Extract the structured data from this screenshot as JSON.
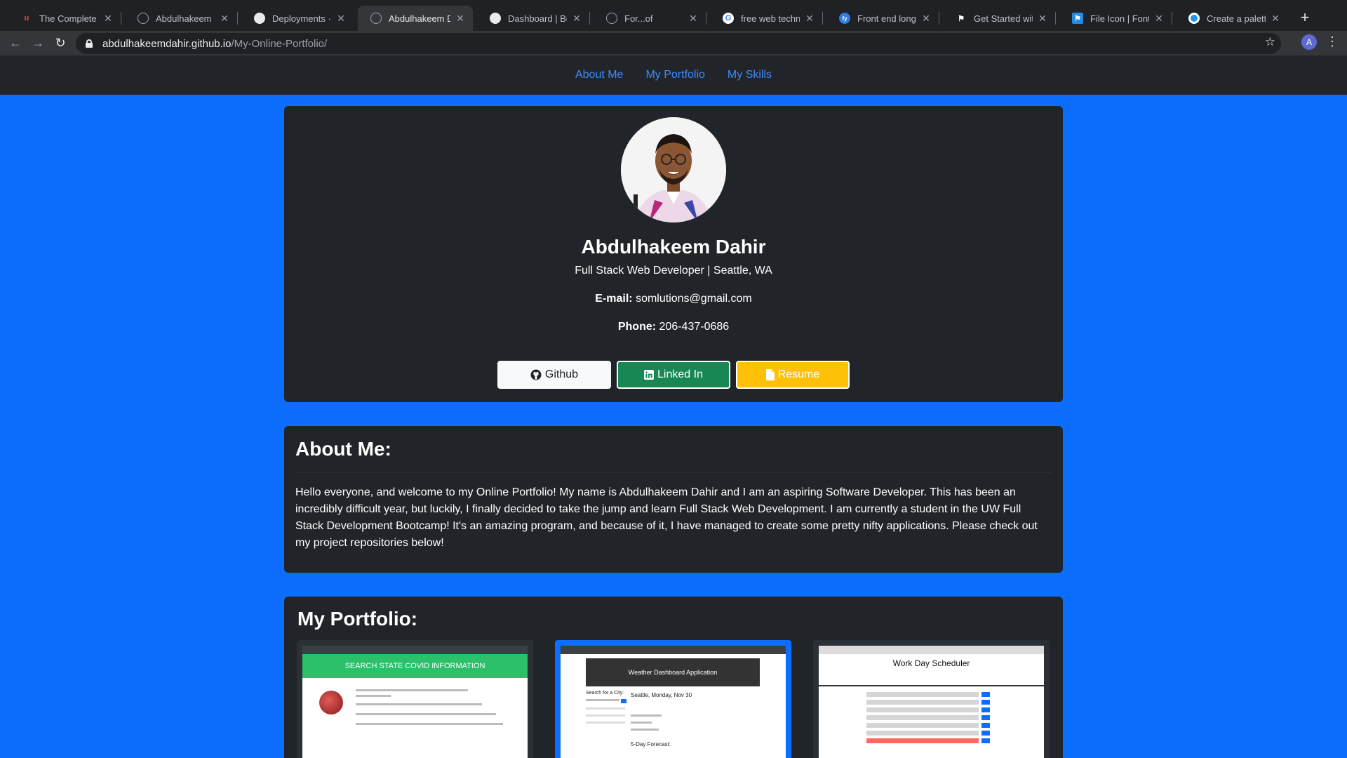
{
  "browser": {
    "tabs": [
      {
        "title": "The Complete JavaScript",
        "icon": "udemy-icon"
      },
      {
        "title": "Abdulhakeem Dahir",
        "icon": "globe-icon"
      },
      {
        "title": "Deployments · abdulhakeemdahir",
        "icon": "github-icon"
      },
      {
        "title": "Abdulhakeem Dahir",
        "icon": "globe-icon",
        "active": true
      },
      {
        "title": "Dashboard | Bootstrap",
        "icon": "github-icon"
      },
      {
        "title": "For...of",
        "icon": "globe-icon"
      },
      {
        "title": "free web technologies",
        "icon": "google-icon"
      },
      {
        "title": "Front end long shadow",
        "icon": "fy-icon"
      },
      {
        "title": "Get Started with Font Awesome",
        "icon": "flag-icon"
      },
      {
        "title": "File Icon | Font Awesome",
        "icon": "flag-icon"
      },
      {
        "title": "Create a palette",
        "icon": "coolors-icon"
      }
    ],
    "url_host": "abdulhakeemdahir.github.io",
    "url_path": "/My-Online-Portfolio/",
    "profile_initial": "A"
  },
  "nav": {
    "links": [
      "About Me",
      "My Portfolio",
      "My Skills"
    ]
  },
  "profile": {
    "name": "Abdulhakeem Dahir",
    "subtitle": "Full Stack Web Developer | Seattle, WA",
    "email_label": "E-mail:",
    "email": "somlutions@gmail.com",
    "phone_label": "Phone:",
    "phone": "206-437-0686",
    "buttons": {
      "github": "Github",
      "linkedin": "Linked In",
      "resume": "Resume"
    }
  },
  "about": {
    "title": "About Me:",
    "text": "Hello everyone, and welcome to my Online Portfolio! My name is Abdulhakeem Dahir and I am an aspiring Software Developer. This has been an incredibly difficult year, but luckily, I finally decided to take the jump and learn Full Stack Web Development. I am currently a student in the UW Full Stack Development Bootcamp! It's an amazing program, and because of it, I have managed to create some pretty nifty applications. Please check out my project repositories below!"
  },
  "portfolio": {
    "title": "My Portfolio:",
    "projects": [
      {
        "heading": "SEARCH STATE COVID INFORMATION"
      },
      {
        "heading": "Weather Dashboard Application",
        "city_label": "Search for a City:",
        "city_date": "Seattle, Monday, Nov 30",
        "forecast_label": "5-Day Forecast:"
      },
      {
        "heading": "Work Day Scheduler"
      }
    ]
  },
  "colors": {
    "page_bg": "#0d6efd",
    "card_bg": "#212529",
    "link": "#3d8bfd",
    "github_btn": "#f8f9fa",
    "linkedin_btn": "#198754",
    "resume_btn": "#ffc107"
  }
}
